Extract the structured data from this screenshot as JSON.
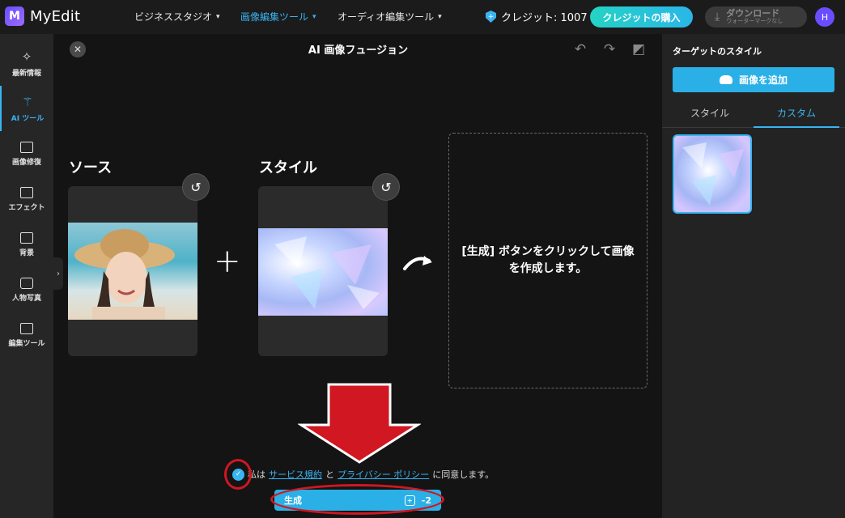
{
  "app": {
    "logo_text": "MyEdit",
    "logo_mark": "M"
  },
  "nav": {
    "items": [
      {
        "label": "ビジネススタジオ",
        "active": false
      },
      {
        "label": "画像編集ツール",
        "active": true
      },
      {
        "label": "オーディオ編集ツール",
        "active": false
      }
    ],
    "credit_label": "クレジット: 1007",
    "buy_label": "クレジットの購入",
    "download_label": "ダウンロード",
    "download_sub": "ウォーターマークなし",
    "avatar_initial": "H"
  },
  "sidebar": {
    "items": [
      {
        "label": "最新情報",
        "icon": "sparkle-icon",
        "active": false
      },
      {
        "label": "AI ツール",
        "icon": "magic-wand-icon",
        "active": true
      },
      {
        "label": "画像修復",
        "icon": "image-repair-icon",
        "active": false
      },
      {
        "label": "エフェクト",
        "icon": "effect-icon",
        "active": false
      },
      {
        "label": "背景",
        "icon": "background-icon",
        "active": false
      },
      {
        "label": "人物写真",
        "icon": "portrait-icon",
        "active": false
      },
      {
        "label": "編集ツール",
        "icon": "edit-tools-icon",
        "active": false
      }
    ]
  },
  "main": {
    "title": "AI 画像フュージョン",
    "source_label": "ソース",
    "style_label": "スタイル",
    "result_placeholder": "[生成] ボタンをクリックして画像を作成します。",
    "agree": {
      "prefix": "私は",
      "terms_link": "サービス規約",
      "and": "と",
      "privacy_link": "プライバシー ポリシー",
      "suffix": "に同意します。"
    },
    "generate_label": "生成",
    "generate_cost": "-2"
  },
  "right_panel": {
    "title": "ターゲットのスタイル",
    "add_image_label": "画像を追加",
    "tabs": [
      {
        "label": "スタイル",
        "active": false
      },
      {
        "label": "カスタム",
        "active": true
      }
    ]
  },
  "colors": {
    "accent": "#3ab4f2",
    "annotation_red": "#d01722"
  }
}
